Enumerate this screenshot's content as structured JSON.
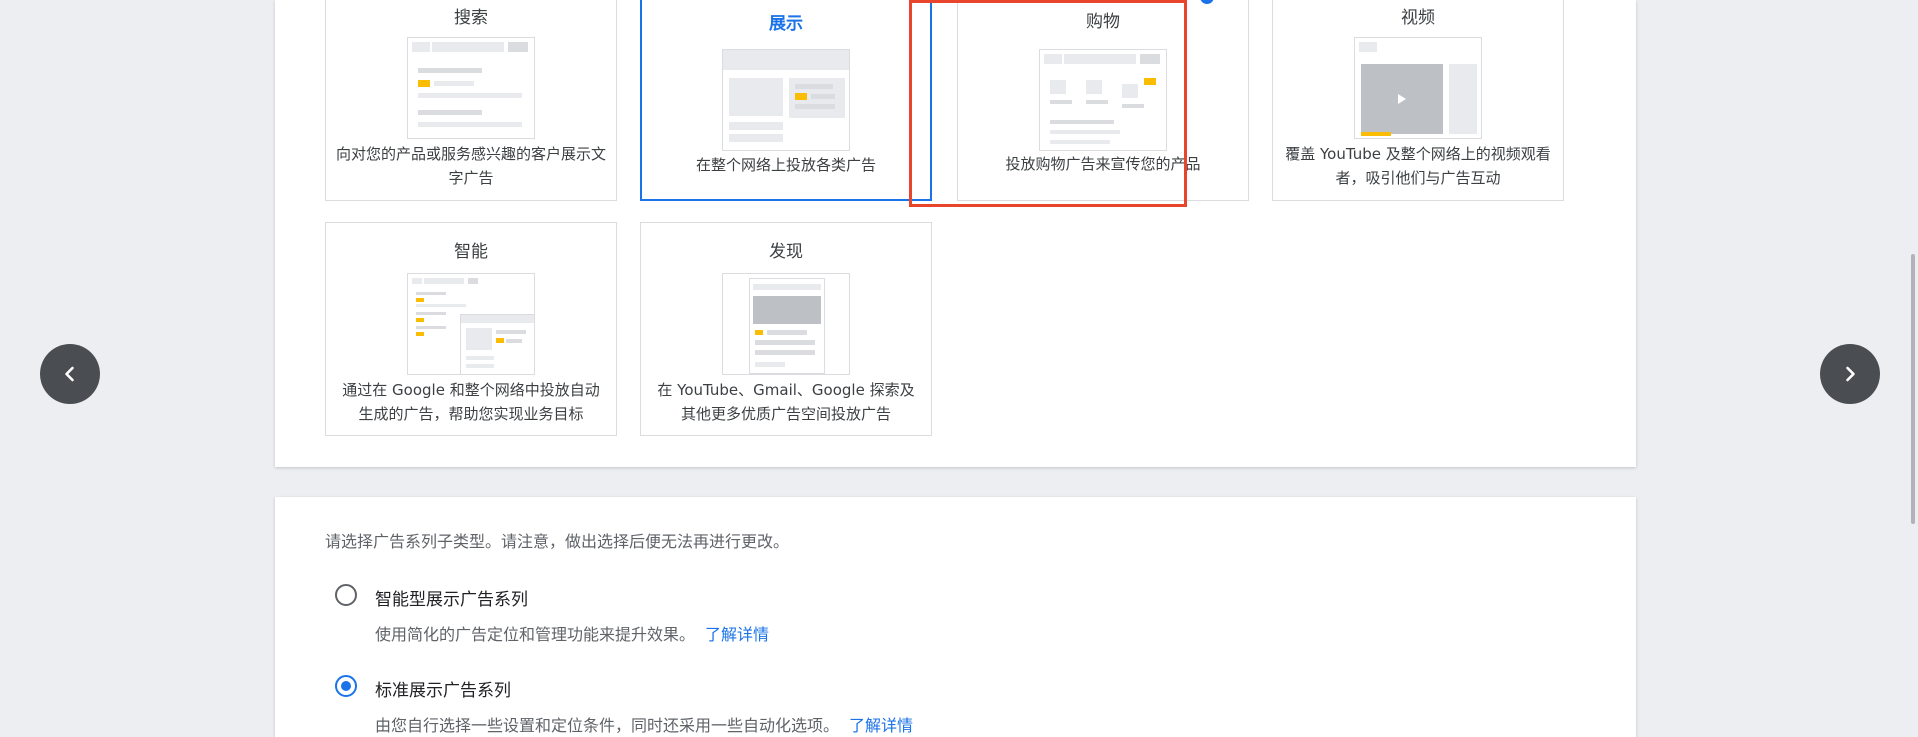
{
  "campaign_types": [
    {
      "title": "搜索",
      "desc": "向对您的产品或服务感兴趣的客户展示文字广告",
      "selected": false
    },
    {
      "title": "展示",
      "desc": "在整个网络上投放各类广告",
      "selected": true
    },
    {
      "title": "购物",
      "desc": "投放购物广告来宣传您的产品",
      "selected": false
    },
    {
      "title": "视频",
      "desc": "覆盖 YouTube 及整个网络上的视频观看者，吸引他们与广告互动",
      "selected": false
    },
    {
      "title": "智能",
      "desc": "通过在 Google 和整个网络中投放自动生成的广告，帮助您实现业务目标",
      "selected": false
    },
    {
      "title": "发现",
      "desc": "在 YouTube、Gmail、Google 探索及其他更多优质广告空间投放广告",
      "selected": false
    }
  ],
  "subtype": {
    "instruction": "请选择广告系列子类型。请注意，做出选择后便无法再进行更改。",
    "options": [
      {
        "label": "智能型展示广告系列",
        "desc": "使用简化的广告定位和管理功能来提升效果。",
        "link": "了解详情",
        "checked": false
      },
      {
        "label": "标准展示广告系列",
        "desc": "由您自行选择一些设置和定位条件，同时还采用一些自动化选项。",
        "link": "了解详情",
        "checked": true
      }
    ]
  },
  "nav": {
    "prev_icon": "chevron-left-icon",
    "next_icon": "chevron-right-icon"
  },
  "colors": {
    "accent": "#1a73e8",
    "highlight": "#e8452c",
    "thumb_accent": "#fbbc04"
  }
}
